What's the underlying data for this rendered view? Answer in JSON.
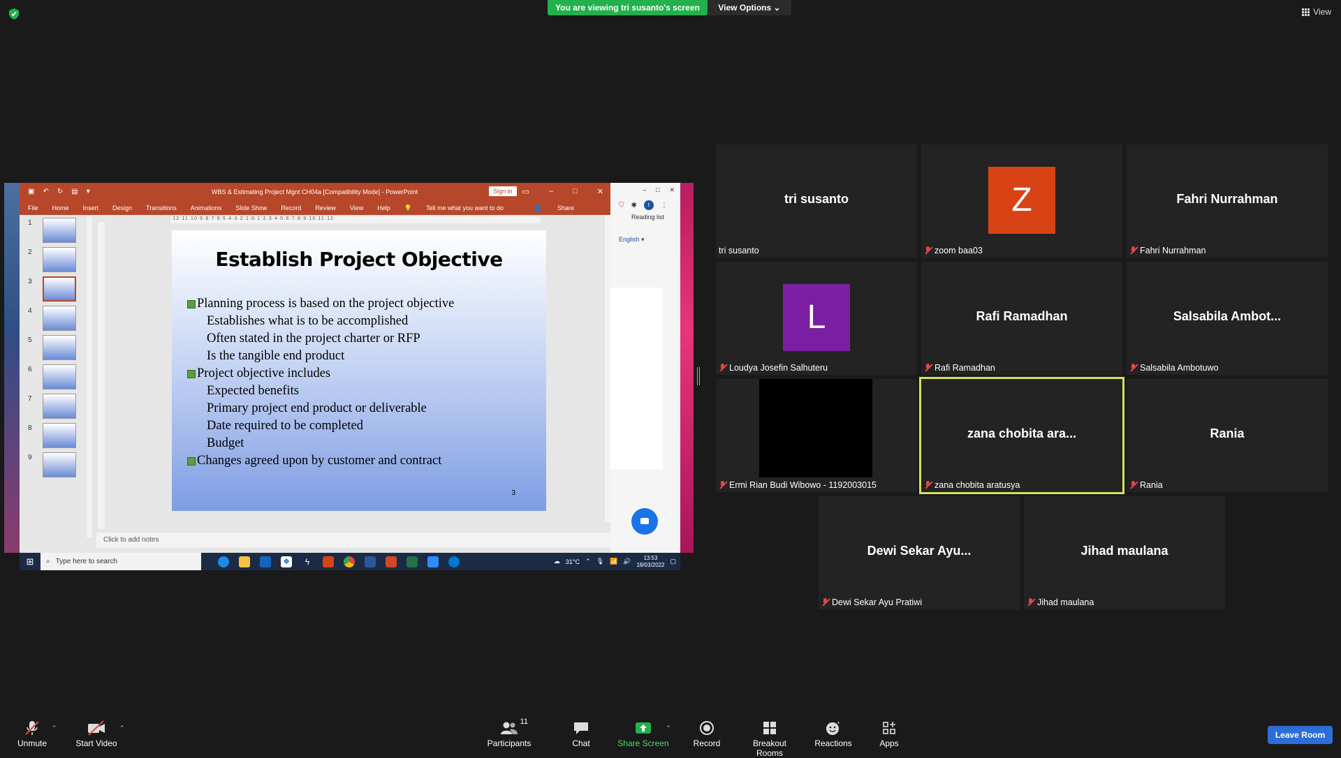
{
  "top": {
    "banner": "You are viewing tri susanto's screen",
    "view_options": "View Options",
    "view": "View"
  },
  "shared_screen": {
    "ppt_title": "WBS & Estimating Project Mgnt CH04a [Compatibility Mode]  -  PowerPoint",
    "sign_in": "Sign in",
    "menu": [
      "File",
      "Home",
      "Insert",
      "Design",
      "Transitions",
      "Animations",
      "Slide Show",
      "Record",
      "Review",
      "View",
      "Help",
      "Tell me what you want to do"
    ],
    "share": "Share",
    "ruler": "·12·11·10·9·8·7·6·5·4·3·2·1·0·1·2·3·4·5·6·7·8·9·10·11·12·",
    "thumbnails": [
      "1",
      "2",
      "3",
      "4",
      "5",
      "6",
      "7",
      "8",
      "9"
    ],
    "slide": {
      "title": "Establish Project Objective",
      "lines": [
        {
          "type": "bullet",
          "text": "Planning process is based on the project objective"
        },
        {
          "type": "sub",
          "text": "Establishes what is to be accomplished"
        },
        {
          "type": "sub",
          "text": "Often stated in the project charter or RFP"
        },
        {
          "type": "sub",
          "text": "Is the tangible end product"
        },
        {
          "type": "bullet",
          "text": "Project objective includes"
        },
        {
          "type": "sub",
          "text": "Expected benefits"
        },
        {
          "type": "sub",
          "text": "Primary project end product or deliverable"
        },
        {
          "type": "sub",
          "text": "Date required to be completed"
        },
        {
          "type": "sub",
          "text": "Budget"
        },
        {
          "type": "bullet",
          "text": "Changes agreed upon by customer and contract"
        }
      ],
      "number": "3"
    },
    "notes": "Click to add notes",
    "edge": {
      "reading_list": "Reading list",
      "language": "English",
      "avatar": "t"
    },
    "taskbar": {
      "search": "Type here to search",
      "weather": "31°C",
      "time": "13:53",
      "date": "18/03/2022"
    }
  },
  "participants": [
    {
      "center": "tri susanto",
      "label": "tri susanto",
      "muted": false
    },
    {
      "center": "",
      "label": "zoom baa03",
      "muted": true,
      "avatar_letter": "Z",
      "avatar_color": "#d84315"
    },
    {
      "center": "Fahri Nurrahman",
      "label": "Fahri Nurrahman",
      "muted": true
    },
    {
      "center": "",
      "label": "Loudya Josefin Salhuteru",
      "muted": true,
      "avatar_letter": "L",
      "avatar_color": "#7b1fa2"
    },
    {
      "center": "Rafi Ramadhan",
      "label": "Rafi Ramadhan",
      "muted": true
    },
    {
      "center": "Salsabila  Ambot...",
      "label": "Salsabila Ambotuwo",
      "muted": true
    },
    {
      "center": "",
      "label": "Ermi Rian Budi Wibowo - 1192003015",
      "muted": true
    },
    {
      "center": "zana chobita ara...",
      "label": "zana chobita aratusya",
      "muted": true
    },
    {
      "center": "Rania",
      "label": "Rania",
      "muted": true
    },
    {
      "center": "Dewi Sekar Ayu...",
      "label": "Dewi Sekar Ayu Pratiwi",
      "muted": true
    },
    {
      "center": "Jihad maulana",
      "label": "Jihad maulana",
      "muted": true
    }
  ],
  "toolbar": {
    "unmute": "Unmute",
    "start_video": "Start Video",
    "participants": "Participants",
    "participant_count": "11",
    "chat": "Chat",
    "share_screen": "Share Screen",
    "record": "Record",
    "breakout_rooms": "Breakout Rooms",
    "reactions": "Reactions",
    "apps": "Apps",
    "leave_room": "Leave Room"
  },
  "colors": {
    "banner_green": "#22b14c",
    "active_speaker": "#d6e05a",
    "leave_blue": "#2d6dd6",
    "share_green": "#22b14c"
  }
}
